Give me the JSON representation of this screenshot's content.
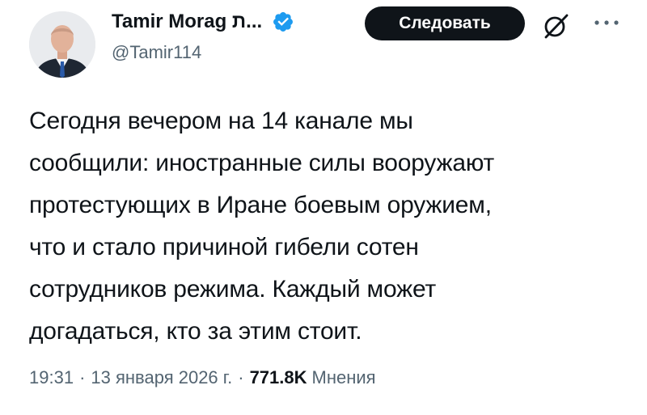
{
  "author": {
    "display_name": "Tamir Morag ת...",
    "handle": "@Tamir114",
    "verified": true
  },
  "actions": {
    "follow_label": "Следовать",
    "grok_icon": "grok-slash-icon",
    "more_icon": "more-dots-icon"
  },
  "tweet": {
    "lines": [
      "Сегодня вечером на 14 канале мы",
      "сообщили: иностранные силы вооружают",
      "протестующих в Иране боевым оружием,",
      "что и стало причиной гибели сотен",
      "сотрудников режима. Каждый может",
      "догадаться, кто за этим стоит."
    ]
  },
  "meta": {
    "time": "19:31",
    "date": "13 января 2026 г.",
    "separator": "·",
    "views_count": "771.8K",
    "views_label": "Мнения"
  },
  "colors": {
    "text_primary": "#0f1419",
    "text_secondary": "#536471",
    "verified_blue": "#1d9bf0",
    "button_bg": "#0f1419"
  }
}
